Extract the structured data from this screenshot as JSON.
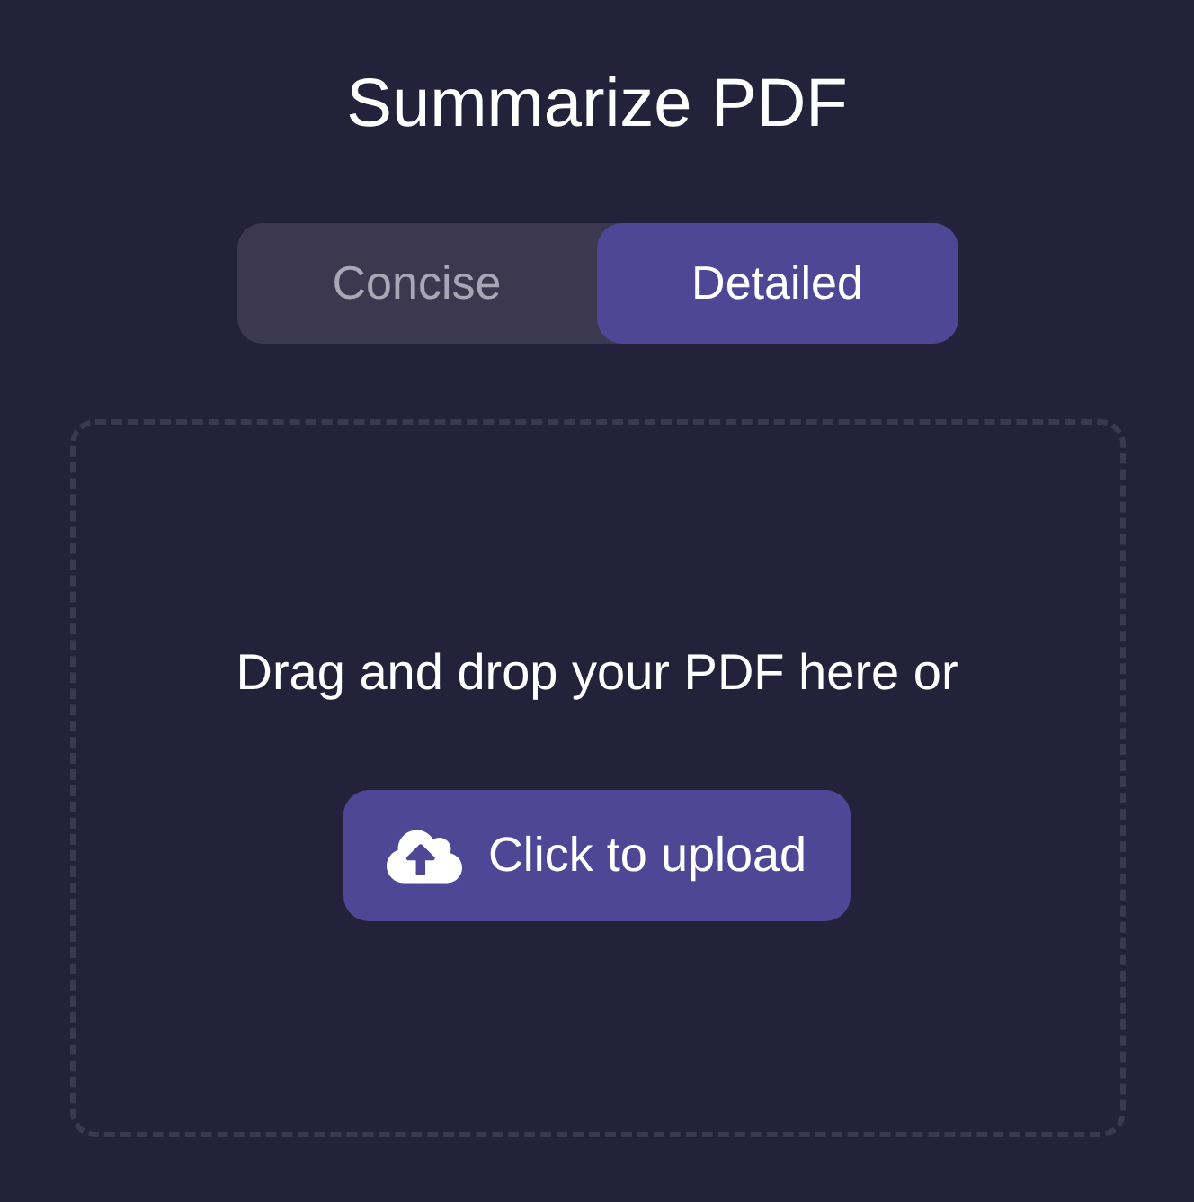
{
  "title": "Summarize PDF",
  "mode_tabs": [
    {
      "label": "Concise",
      "selected": false
    },
    {
      "label": "Detailed",
      "selected": true
    }
  ],
  "dropzone": {
    "prompt": "Drag and drop your PDF here or",
    "upload_button": "Click to upload"
  }
}
